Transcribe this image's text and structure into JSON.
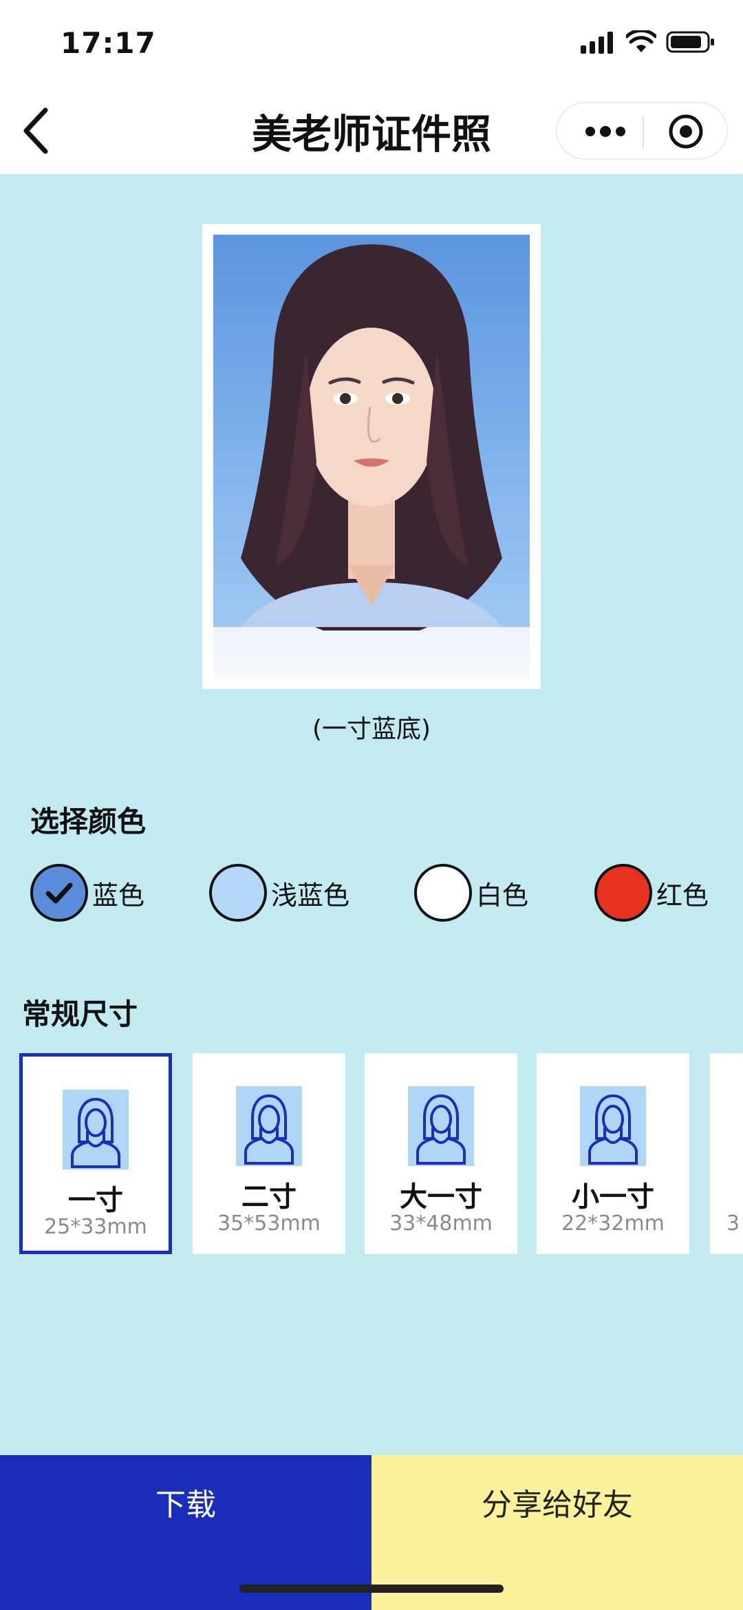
{
  "status_bar": {
    "time": "17:17"
  },
  "nav": {
    "title": "美老师证件照",
    "back_icon": "chevron-left-icon",
    "more_icon": "more-dots-icon",
    "close_icon": "target-icon"
  },
  "photo": {
    "caption": "(一寸蓝底)",
    "background_color": "#5b95df"
  },
  "color_section": {
    "title": "选择颜色",
    "options": [
      {
        "label": "蓝色",
        "color": "#5b8ddb",
        "selected": true
      },
      {
        "label": "浅蓝色",
        "color": "#b4d9f8",
        "selected": false
      },
      {
        "label": "白色",
        "color": "#ffffff",
        "selected": false
      },
      {
        "label": "红色",
        "color": "#e8321f",
        "selected": false
      }
    ]
  },
  "size_section": {
    "title": "常规尺寸",
    "items": [
      {
        "name": "一寸",
        "dimensions": "25*33mm",
        "selected": true
      },
      {
        "name": "二寸",
        "dimensions": "35*53mm",
        "selected": false
      },
      {
        "name": "大一寸",
        "dimensions": "33*48mm",
        "selected": false
      },
      {
        "name": "小一寸",
        "dimensions": "22*32mm",
        "selected": false
      },
      {
        "name": "",
        "dimensions": "3",
        "selected": false
      }
    ]
  },
  "actions": {
    "download_label": "下载",
    "share_label": "分享给好友"
  },
  "colors": {
    "accent": "#1a2dbb",
    "share_bg": "#fbf29b",
    "page_bg": "#c4eaf1"
  }
}
